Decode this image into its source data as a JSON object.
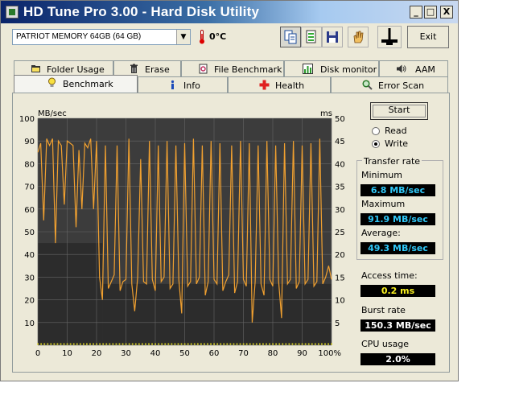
{
  "window": {
    "title": "HD Tune Pro 3.00 - Hard Disk Utility",
    "controls": {
      "minimize": "_",
      "maximize": "□",
      "close": "X"
    }
  },
  "toolbar": {
    "drive": "PATRIOT MEMORY 64GB (64 GB)",
    "temperature": "0°C",
    "exit_label": "Exit"
  },
  "tabs": {
    "row1": [
      "Folder Usage",
      "Erase",
      "File Benchmark",
      "Disk monitor",
      "AAM"
    ],
    "row2": [
      "Benchmark",
      "Info",
      "Health",
      "Error Scan"
    ],
    "active": "Benchmark"
  },
  "benchmark": {
    "start_label": "Start",
    "read_label": "Read",
    "write_label": "Write",
    "selected_mode": "Write",
    "transfer_rate_title": "Transfer rate",
    "minimum_label": "Minimum",
    "minimum_value": "6.8 MB/sec",
    "maximum_label": "Maximum",
    "maximum_value": "91.9 MB/sec",
    "average_label": "Average:",
    "average_value": "49.3 MB/sec",
    "access_time_label": "Access time:",
    "access_time_value": "0.2 ms",
    "burst_rate_label": "Burst rate",
    "burst_rate_value": "150.3 MB/sec",
    "cpu_usage_label": "CPU usage",
    "cpu_usage_value": "2.0%"
  },
  "colors": {
    "transfer_line": "#f0a030",
    "access_points": "#e8e020",
    "value_cyan": "#30c8f8",
    "value_yellow": "#f8f020",
    "value_white": "#ffffff",
    "plot_bg": "#3c3c3c",
    "plot_bg_dark": "#2c2c2c",
    "grid": "#666666"
  },
  "chart_data": {
    "type": "line",
    "left_axis_label": "MB/sec",
    "right_axis_label": "ms",
    "ylim_left": [
      0,
      100
    ],
    "ylim_right": [
      0,
      50
    ],
    "xlim": [
      0,
      100
    ],
    "yticks_left": [
      "10",
      "20",
      "30",
      "40",
      "50",
      "60",
      "70",
      "80",
      "90",
      "100"
    ],
    "yticks_right": [
      "5",
      "10",
      "15",
      "20",
      "25",
      "30",
      "35",
      "40",
      "45",
      "50"
    ],
    "xticks": [
      "0",
      "10",
      "20",
      "30",
      "40",
      "50",
      "60",
      "70",
      "80",
      "90",
      "100%"
    ],
    "grid": true,
    "series": [
      {
        "x": [
          0,
          1,
          2,
          3,
          4,
          5,
          6,
          7,
          8,
          9,
          10,
          11,
          12,
          13,
          14,
          15,
          16,
          17,
          18,
          19,
          20,
          21,
          22,
          23,
          24,
          25,
          26,
          27,
          28,
          29,
          30,
          31,
          32,
          33,
          34,
          35,
          36,
          37,
          38,
          39,
          40,
          41,
          42,
          43,
          44,
          45,
          46,
          47,
          48,
          49,
          50,
          51,
          52,
          53,
          54,
          55,
          56,
          57,
          58,
          59,
          60,
          61,
          62,
          63,
          64,
          65,
          66,
          67,
          68,
          69,
          70,
          71,
          72,
          73,
          74,
          75,
          76,
          77,
          78,
          79,
          80,
          81,
          82,
          83,
          84,
          85,
          86,
          87,
          88,
          89,
          90,
          91,
          92,
          93,
          94,
          95,
          96,
          97,
          98,
          99,
          100
        ],
        "values": [
          85,
          89,
          55,
          91,
          88,
          91,
          45,
          90,
          88,
          62,
          90,
          89,
          88,
          52,
          86,
          60,
          89,
          87,
          91,
          60,
          90,
          30,
          20,
          88,
          25,
          28,
          31,
          88,
          24,
          28,
          29,
          91,
          27,
          15,
          30,
          82,
          28,
          27,
          90,
          29,
          24,
          88,
          28,
          30,
          90,
          25,
          27,
          88,
          29,
          14,
          89,
          26,
          28,
          91,
          27,
          30,
          88,
          22,
          28,
          90,
          29,
          27,
          89,
          24,
          28,
          31,
          88,
          23,
          28,
          90,
          29,
          26,
          89,
          10,
          28,
          88,
          27,
          22,
          90,
          29,
          26,
          88,
          28,
          12,
          89,
          27,
          29,
          90,
          25,
          28,
          88,
          27,
          29,
          89,
          26,
          28,
          91,
          27,
          30,
          35,
          29
        ]
      }
    ],
    "access_time_ms": 0.2
  }
}
